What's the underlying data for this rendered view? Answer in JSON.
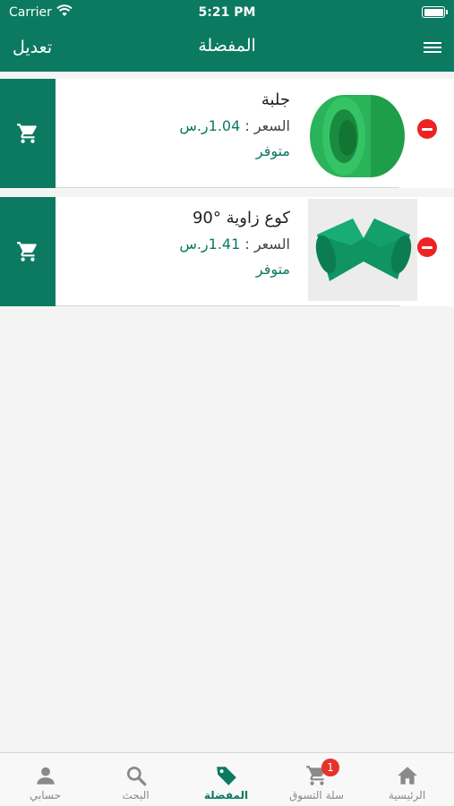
{
  "status_bar": {
    "carrier": "Carrier",
    "time": "5:21 PM"
  },
  "nav": {
    "edit_label": "تعديل",
    "title": "المفضلة"
  },
  "favorites": [
    {
      "name": "جلبة",
      "price_label": "السعر :",
      "price_value": "1.04ر.س",
      "availability": "متوفر",
      "image_icon": "green-pipe-socket-image"
    },
    {
      "name": "كوع زاوية °90",
      "price_label": "السعر :",
      "price_value": "1.41ر.س",
      "availability": "متوفر",
      "image_icon": "green-elbow-90-image"
    }
  ],
  "tabs": [
    {
      "label": "حسابي",
      "icon": "person-icon"
    },
    {
      "label": "البحث",
      "icon": "search-icon"
    },
    {
      "label": "المفضلة",
      "icon": "tag-icon",
      "active": true
    },
    {
      "label": "سلة التسوق",
      "icon": "cart-icon",
      "badge": "1"
    },
    {
      "label": "الرئيسية",
      "icon": "home-icon"
    }
  ],
  "colors": {
    "primary": "#0b7a60",
    "remove": "#e22222",
    "badge": "#e6322b"
  }
}
